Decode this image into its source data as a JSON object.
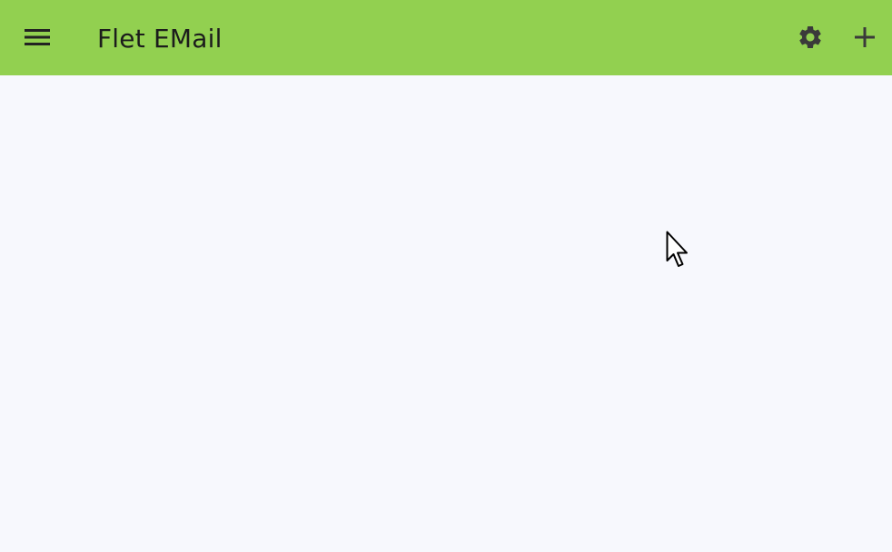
{
  "app": {
    "title": "Flet EMail"
  },
  "icons": {
    "menu": "menu-icon",
    "settings": "gear-icon",
    "add": "plus-icon",
    "cursor": "mouse-pointer-icon"
  },
  "colors": {
    "appbar_bg": "#92d050",
    "content_bg": "#f7f8fd",
    "icon_color": "#222222"
  }
}
